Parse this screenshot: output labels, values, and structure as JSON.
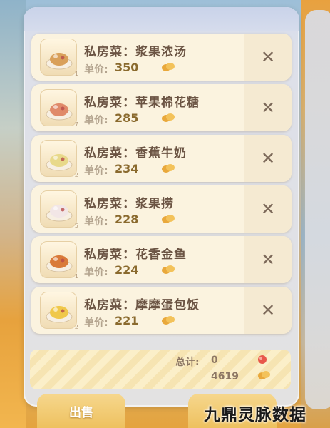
{
  "items": [
    {
      "prefix": "私房菜：",
      "name": "浆果浓汤",
      "price_label": "单价:",
      "price": "350",
      "badge": "1",
      "dish_color": "#d9a05a"
    },
    {
      "prefix": "私房菜：",
      "name": "苹果棉花糖",
      "price_label": "单价:",
      "price": "285",
      "badge": "7",
      "dish_color": "#e08a6a"
    },
    {
      "prefix": "私房菜：",
      "name": "香蕉牛奶",
      "price_label": "单价:",
      "price": "234",
      "badge": "2",
      "dish_color": "#e8d98a"
    },
    {
      "prefix": "私房菜：",
      "name": "浆果捞",
      "price_label": "单价:",
      "price": "228",
      "badge": "5",
      "dish_color": "#f2e6e6"
    },
    {
      "prefix": "私房菜：",
      "name": "花香金鱼",
      "price_label": "单价:",
      "price": "224",
      "badge": "1",
      "dish_color": "#d97a3a"
    },
    {
      "prefix": "私房菜：",
      "name": "摩摩蛋包饭",
      "price_label": "单价:",
      "price": "221",
      "badge": "2",
      "dish_color": "#f0c84a"
    }
  ],
  "close_symbol": "✕",
  "total": {
    "label": "总计:",
    "count": "0",
    "gold": "4619"
  },
  "buttons": {
    "sell": "出售"
  },
  "watermark": "九鼎灵脉数据",
  "colors": {
    "item_bg": "#fbf3df",
    "text_brown": "#6b5443",
    "price_brown": "#8a6a2e",
    "button_gold": "#eec15f"
  }
}
